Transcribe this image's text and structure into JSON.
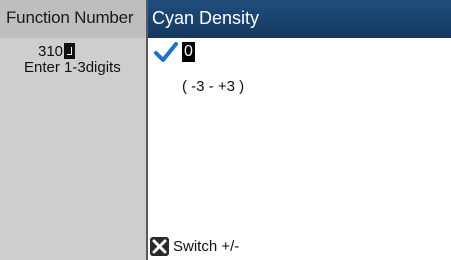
{
  "function_panel": {
    "title": "Function Number",
    "value": "310",
    "hint": "Enter 1-3digits"
  },
  "dialog": {
    "title": "Cyan Density",
    "selected_value": "0",
    "range": "( -3 - +3 )",
    "footer_action": "Switch +/-",
    "accent_color": "#1f4e7c",
    "check_color": "#1f72c8"
  },
  "icons": {
    "check": "check-icon",
    "switch": "x-button-icon",
    "enter": "enter-return-icon"
  }
}
